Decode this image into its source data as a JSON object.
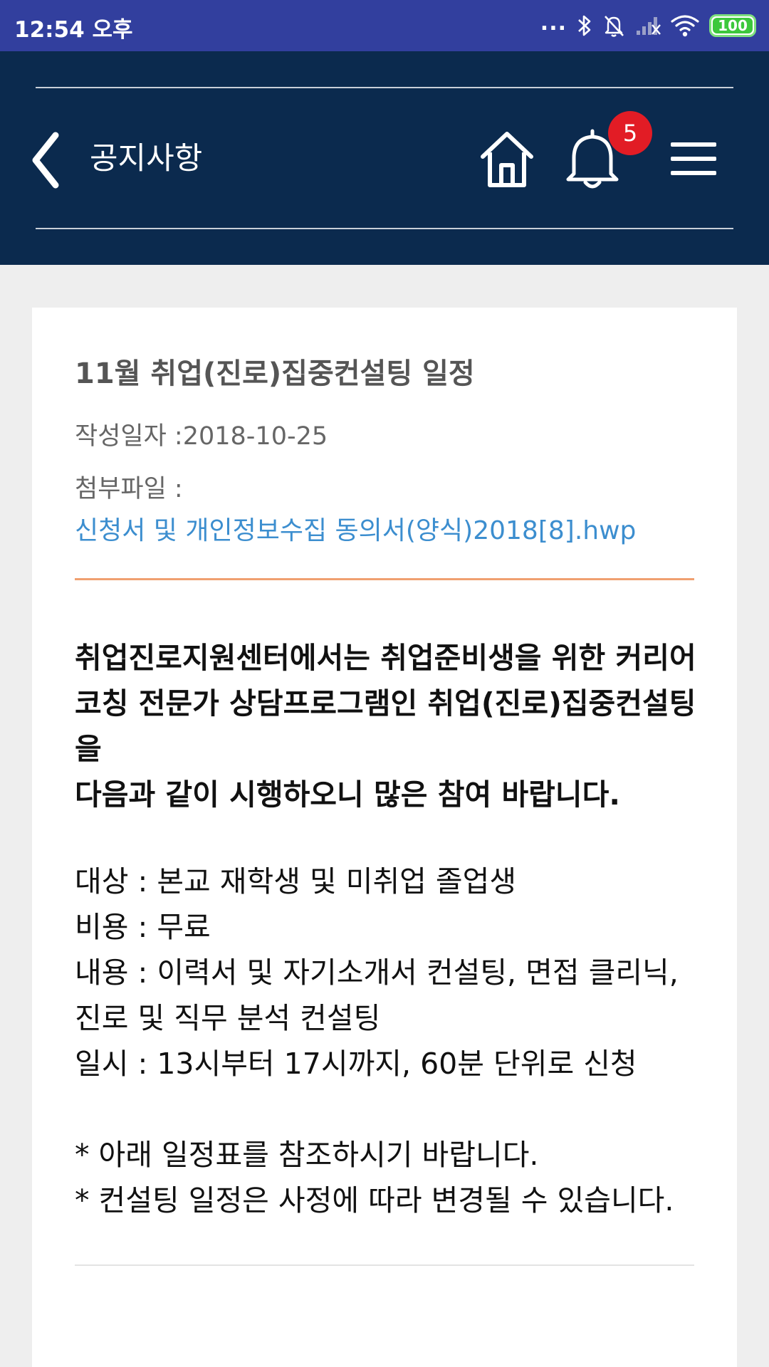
{
  "status_bar": {
    "time": "12:54 오후",
    "icons": [
      "more-dots-icon",
      "bluetooth-icon",
      "notifications-off-icon",
      "cellular-signal-icon",
      "wifi-icon",
      "battery-icon"
    ],
    "dots": "...",
    "battery_level": "100"
  },
  "header": {
    "title": "공지사항",
    "notification_count": "5",
    "colors": {
      "background": "#0b2a4e",
      "badge": "#e21c25"
    }
  },
  "post": {
    "title": "11월 취업(진로)집중컨설팅 일정",
    "date_line": "작성일자 :2018-10-25",
    "attachment_label": "첨부파일 :",
    "attachment_file": "신청서 및 개인정보수집 동의서(양식)2018[8].hwp",
    "intro_line1": "취업진로지원센터에서는 취업준비생을 위한 커리어 코칭 전문가 상담프로그램인 취업(진로)집중컨설팅을",
    "intro_line2": "다음과 같이 시행하오니 많은 참여 바랍니다.",
    "target": "대상 : 본교 재학생 및 미취업 졸업생",
    "cost": "비용 : 무료",
    "content": "내용 : 이력서 및 자기소개서 컨설팅, 면접 클리닉, 진로 및 직무 분석 컨설팅",
    "schedule": "일시 : 13시부터 17시까지, 60분 단위로 신청",
    "note1": "* 아래 일정표를 참조하시기 바랍니다.",
    "note2": "* 컨설팅 일정은 사정에 따라 변경될 수 있습니다."
  }
}
